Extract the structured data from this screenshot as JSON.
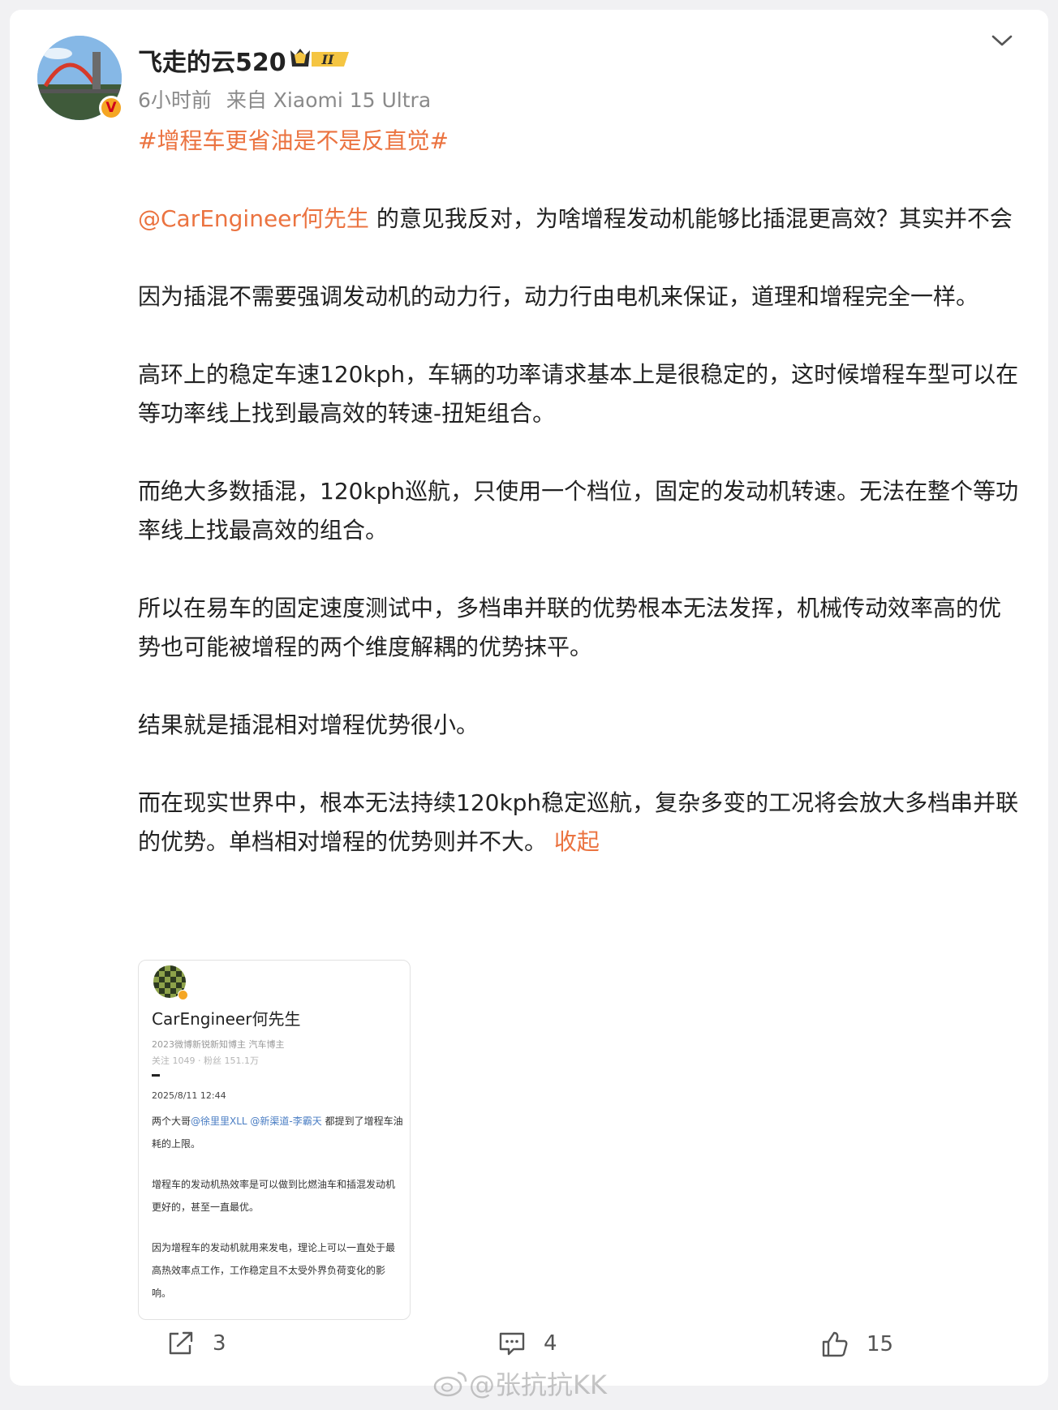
{
  "post": {
    "author": "飞走的云520",
    "rank_badge": "II",
    "verified_badge": "V",
    "time": "6小时前",
    "source": "来自 Xiaomi 15 Ultra",
    "hashtag": "#增程车更省油是不是反直觉#",
    "mention": "@CarEngineer何先生",
    "p1_rest": " 的意见我反对，为啥增程发动机能够比插混更高效？其实并不会",
    "p2": "因为插混不需要强调发动机的动力行，动力行由电机来保证，道理和增程完全一样。",
    "p3": "高环上的稳定车速120kph，车辆的功率请求基本上是很稳定的，这时候增程车型可以在等功率线上找到最高效的转速-扭矩组合。",
    "p4": "而绝大多数插混，120kph巡航，只使用一个档位，固定的发动机转速。无法在整个等功率线上找最高效的组合。",
    "p5": "所以在易车的固定速度测试中，多档串并联的优势根本无法发挥，机械传动效率高的优势也可能被增程的两个维度解耦的优势抹平。",
    "p6": "结果就是插混相对增程优势很小。",
    "p7": "而在现实世界中，根本无法持续120kph稳定巡航，复杂多变的工况将会放大多档串并联的优势。单档相对增程的优势则并不大。",
    "collapse": "收起"
  },
  "image": {
    "name": "CarEngineer何先生",
    "sub1": "2023微博新锐新知博主 汽车博主",
    "sub2": "关注 1049 · 粉丝 151.1万",
    "date": "2025/8/11 12:44",
    "t1_a": "两个大哥",
    "t1_link": "@徐里里XLL @新渠道-李霸天",
    "t1_b": " 都提到了增程车油耗的上限。",
    "t2": "增程车的发动机热效率是可以做到比燃油车和插混发动机更好的，甚至一直最优。",
    "t3": "因为增程车的发动机就用来发电，理论上可以一直处于最高热效率点工作，工作稳定且不太受外界负荷变化的影响。"
  },
  "actions": {
    "repost_count": "3",
    "comment_count": "4",
    "like_count": "15"
  },
  "watermark": "@张抗抗KK",
  "colors": {
    "accent": "#eb7340",
    "background": "#f1f1f3"
  },
  "icons": [
    "chevron-down-icon",
    "repost-icon",
    "comment-icon",
    "like-icon",
    "weibo-logo-icon"
  ]
}
